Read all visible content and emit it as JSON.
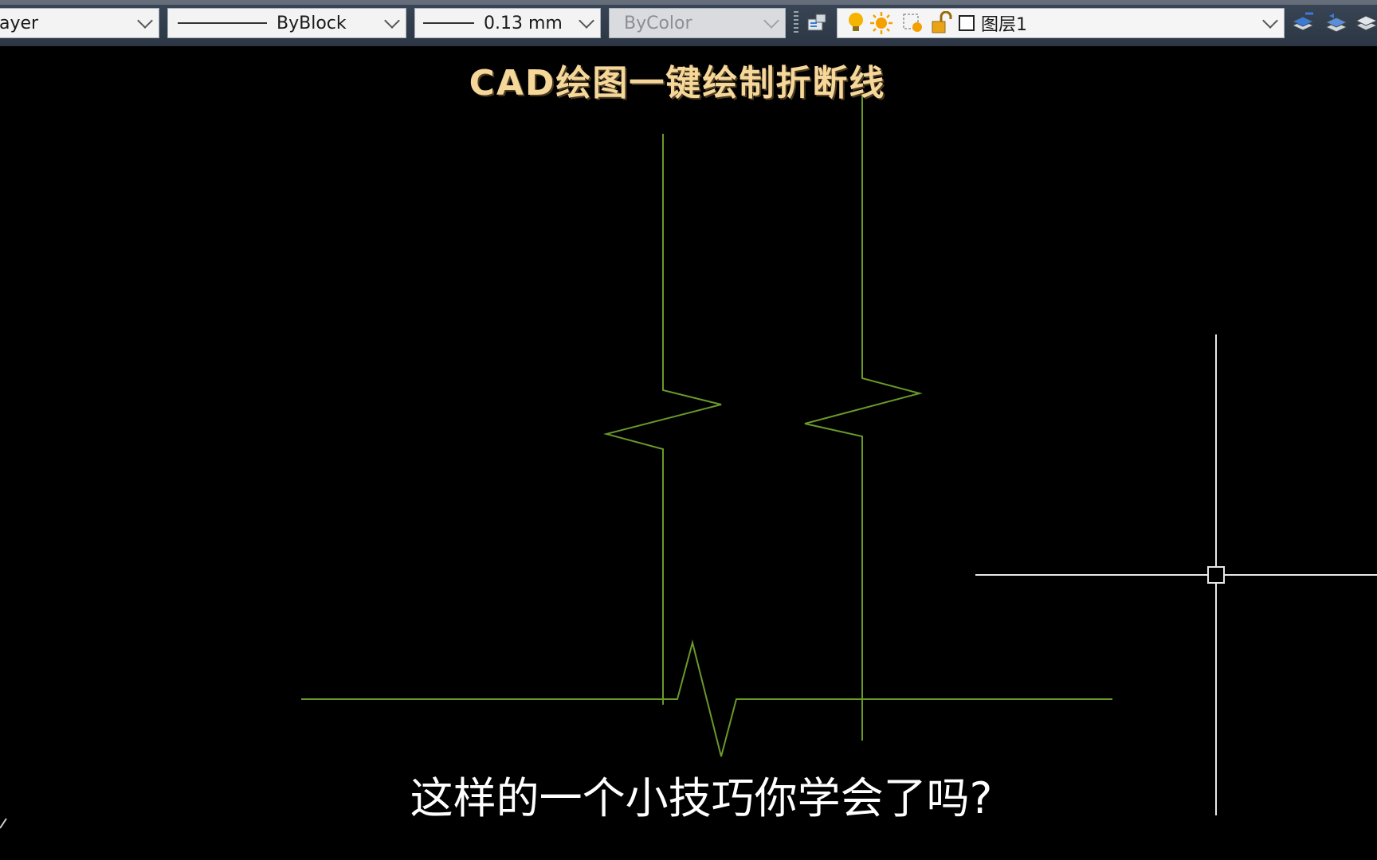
{
  "toolbar": {
    "layer_combo": {
      "value": "ayer"
    },
    "linetype_combo": {
      "value": "ByBlock"
    },
    "lineweight_combo": {
      "value": "0.13 mm"
    },
    "plotstyle_combo": {
      "value": "ByColor"
    },
    "layer_state_combo": {
      "value": "图层1"
    }
  },
  "overlay": {
    "title": "CAD绘图一键绘制折断线",
    "subtitle": "这样的一个小技巧你学会了吗?"
  },
  "colors": {
    "drawing_line": "#6a9a2a",
    "crosshair": "#e8e8e8",
    "title": "#f6d79a",
    "toolbar_bg": "#34404f"
  },
  "icons": [
    "layer-properties-icon",
    "bulb-icon",
    "sun-icon",
    "freeze-viewport-icon",
    "unlock-icon",
    "color-swatch-icon",
    "layer-match-icon",
    "layer-previous-icon",
    "layer-state-icon"
  ]
}
